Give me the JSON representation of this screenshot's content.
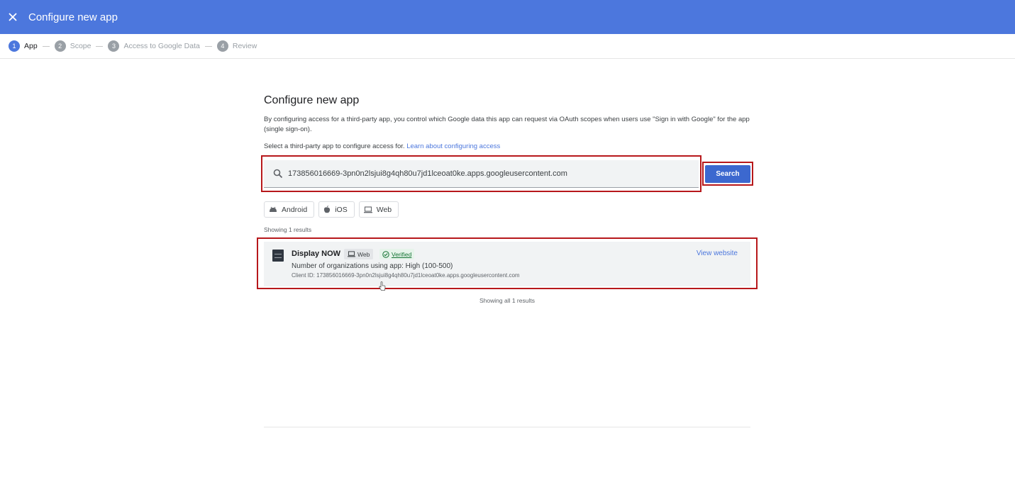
{
  "header": {
    "title": "Configure new app",
    "close_icon": "close-icon",
    "bg_color": "#4c77dd"
  },
  "stepper": {
    "steps": [
      {
        "num": "1",
        "label": "App",
        "active": true
      },
      {
        "num": "2",
        "label": "Scope",
        "active": false
      },
      {
        "num": "3",
        "label": "Access to Google Data",
        "active": false
      },
      {
        "num": "4",
        "label": "Review",
        "active": false
      }
    ]
  },
  "main": {
    "title": "Configure new app",
    "description": "By configuring access for a third-party app, you control which Google data this app can request via OAuth scopes when users use \"Sign in with Google\" for the app (single sign-on).",
    "select_text": "Select a third-party app to configure access for.",
    "learn_link": "Learn about configuring access",
    "search": {
      "value": "173856016669-3pn0n2lsjui8g4qh80u7jd1lceoat0ke.apps.googleusercontent.com",
      "button_label": "Search"
    },
    "filters": [
      {
        "label": "Android",
        "icon": "android-icon"
      },
      {
        "label": "iOS",
        "icon": "apple-icon"
      },
      {
        "label": "Web",
        "icon": "laptop-icon"
      }
    ],
    "showing_text": "Showing 1 results",
    "result": {
      "name": "Display NOW",
      "type_badge": "Web",
      "verified_badge": "Verified",
      "view_link": "View website",
      "orgs": "Number of organizations using app: High (100-500)",
      "client_id": "Client ID: 173856016669-3pn0n2lsjui8g4qh80u7jd1lceoat0ke.apps.googleusercontent.com"
    },
    "showing_all_text": "Showing all 1 results"
  },
  "colors": {
    "accent": "#4c77dd",
    "highlight": "#b7181b",
    "verified": "#137333"
  }
}
